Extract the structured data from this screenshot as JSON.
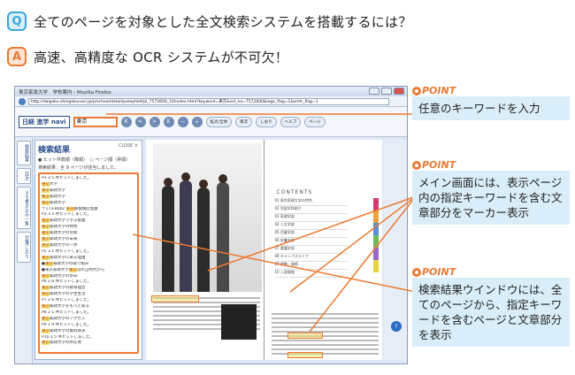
{
  "question": {
    "icon": "Q",
    "text": "全てのページを対象とした全文検索システムを搭載するには？"
  },
  "answer": {
    "icon": "A",
    "text": "高速、高精度な OCR システムが不可欠！"
  },
  "browser": {
    "title": "東京家政大学　学校案内 - Mozilla Firefox",
    "url": "http://daigaku.shingakunavi.jp/p/school/detail/pamphlet/pl_7572600_10/index.html?keyword=東京&sid_no=7572600&logo_flag=1&smtr_flag=1",
    "logo": "日経 進学 navi",
    "keyword": "東京",
    "toolbar": [
      "K",
      "<",
      ">",
      "K",
      "－",
      "＋"
    ],
    "pills": [
      "拡大/全体",
      "目次",
      "しおり",
      "ヘルプ",
      "ページ"
    ],
    "left_tabs": [
      "検索結果",
      "目次",
      "メモ書き込み一覧",
      "付箋/しおり"
    ],
    "results": {
      "title": "検索結果",
      "close": "CLOSE ✕",
      "sub": "● ヒット件数順（降順）　○ ページ順（昇順）",
      "count": "検索結果：全 9 ページが該当しました。",
      "lines": [
        [
          "P3  3 5 件ヒットしました。",
          ""
        ],
        [
          "東京",
          "大学"
        ],
        [
          "東京",
          "家政大学"
        ],
        [
          "東京",
          "家政大学"
        ],
        [
          "東京",
          "家政大学"
        ],
        [
          "〒173-8602 ",
          "東京",
          "都板橋区加賀"
        ],
        [
          "P3  3 3 件ヒットしました。",
          ""
        ],
        [
          "東京",
          "家政大学で学ぶ意義"
        ],
        [
          "東京",
          "家政大学の特色"
        ],
        [
          "東京",
          "家政大学の伝統"
        ],
        [
          "東京",
          "家政大学の未来"
        ],
        [
          "東京",
          "家政大学の一歩"
        ],
        [
          "P5  3 1 件ヒットしました。",
          ""
        ],
        [
          "東京",
          "家政大学に来る理由"
        ],
        [
          "●",
          "東京",
          "家政大学の取り組み"
        ],
        [
          "●東京家政大学",
          "東京",
          "は大正時代から"
        ],
        [
          "東京",
          "家政大学の歩み"
        ],
        [
          "P6  2 8 件ヒットしました。",
          ""
        ],
        [
          "東京",
          "家政大学の教育理念"
        ],
        [
          "東京",
          "家政大学の学生生活"
        ],
        [
          "P7  2 6 件ヒットしました。",
          ""
        ],
        [
          "東京",
          "家政大学をもっと知る"
        ],
        [
          "P8  2 1 件ヒットしました。",
          ""
        ],
        [
          "東京",
          "家政大学のアクセス"
        ],
        [
          "P9  1 9 件ヒットしました。",
          ""
        ],
        [
          "東京",
          "家政大学の資料請求"
        ],
        [
          "P10 1 5 件ヒットしました。",
          ""
        ],
        [
          "東京",
          "家政大学の所在地"
        ]
      ]
    },
    "contents": {
      "heading": "CONTENTS",
      "items": [
        "01 東京家政大学の特色",
        "02 学部学科紹介",
        "03 家政学部",
        "04 人文学部",
        "05 児童学部",
        "06 栄養学部",
        "07 看護学部",
        "08 キャンパスライフ",
        "09 就職・資格",
        "10 入試情報"
      ]
    },
    "help": "?"
  },
  "points": [
    {
      "label": "POINT",
      "text": "任意のキーワードを入力"
    },
    {
      "label": "POINT",
      "text": "メイン画面には、表示ページ内の指定キーワードを含む文章部分をマーカー表示"
    },
    {
      "label": "POINT",
      "text": "検索結果ウインドウには、全てのページから、指定キーワードを含むページと文章部分を表示"
    }
  ],
  "colors": {
    "accent": "#ec7a33",
    "q": "#3aa7d8",
    "box": "#d9eef8"
  }
}
